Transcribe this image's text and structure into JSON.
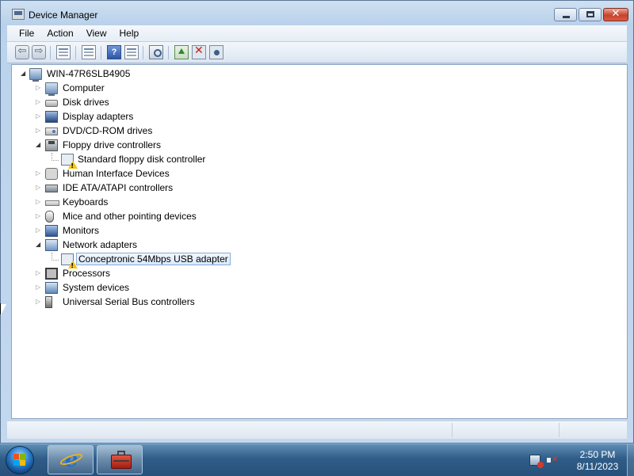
{
  "window": {
    "title": "Device Manager",
    "close_glyph": "✕"
  },
  "menu": [
    "File",
    "Action",
    "View",
    "Help"
  ],
  "toolbar": {
    "back_glyph": "⇦",
    "forward_glyph": "⇨",
    "help_glyph": "?",
    "uninstall_glyph": "✕"
  },
  "tree": {
    "root": "WIN-47R6SLB4905",
    "categories": [
      {
        "label": "Computer",
        "expanded": false,
        "icon": "computer-icon"
      },
      {
        "label": "Disk drives",
        "expanded": false,
        "icon": "disk-drive-icon"
      },
      {
        "label": "Display adapters",
        "expanded": false,
        "icon": "display-adapter-icon"
      },
      {
        "label": "DVD/CD-ROM drives",
        "expanded": false,
        "icon": "dvd-drive-icon"
      },
      {
        "label": "Floppy drive controllers",
        "expanded": true,
        "icon": "floppy-controller-icon",
        "children": [
          {
            "label": "Standard floppy disk controller",
            "warning": true
          }
        ]
      },
      {
        "label": "Human Interface Devices",
        "expanded": false,
        "icon": "hid-icon"
      },
      {
        "label": "IDE ATA/ATAPI controllers",
        "expanded": false,
        "icon": "ide-controller-icon"
      },
      {
        "label": "Keyboards",
        "expanded": false,
        "icon": "keyboard-icon"
      },
      {
        "label": "Mice and other pointing devices",
        "expanded": false,
        "icon": "mouse-icon"
      },
      {
        "label": "Monitors",
        "expanded": false,
        "icon": "monitor-icon"
      },
      {
        "label": "Network adapters",
        "expanded": true,
        "icon": "network-adapter-icon",
        "children": [
          {
            "label": "Conceptronic 54Mbps USB adapter",
            "warning": true,
            "selected": true
          }
        ]
      },
      {
        "label": "Processors",
        "expanded": false,
        "icon": "processor-icon"
      },
      {
        "label": "System devices",
        "expanded": false,
        "icon": "system-devices-icon"
      },
      {
        "label": "Universal Serial Bus controllers",
        "expanded": false,
        "icon": "usb-controller-icon"
      }
    ]
  },
  "taskbar": {
    "time": "2:50 PM",
    "date": "8/11/2023"
  }
}
